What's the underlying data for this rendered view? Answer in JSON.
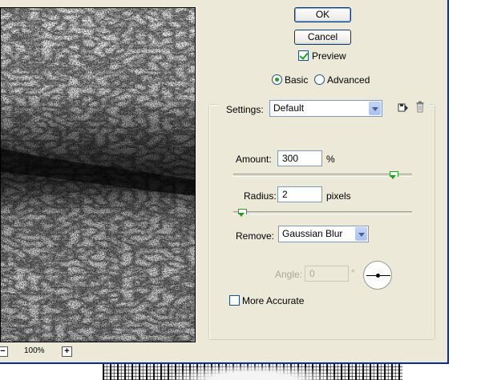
{
  "buttons": {
    "ok": "OK",
    "cancel": "Cancel"
  },
  "preview": {
    "label": "Preview",
    "checked": true
  },
  "mode": {
    "basic": "Basic",
    "advanced": "Advanced",
    "selected": "Basic"
  },
  "settings": {
    "label": "Settings:",
    "value": "Default",
    "save_icon": "save-settings-icon",
    "delete_icon": "trash-icon"
  },
  "amount": {
    "label": "Amount:",
    "value": "300",
    "unit": "%",
    "slider_fraction": 0.92
  },
  "radius": {
    "label": "Radius:",
    "value": "2",
    "unit": "pixels",
    "slider_fraction": 0.02
  },
  "remove": {
    "label": "Remove:",
    "value": "Gaussian Blur"
  },
  "angle": {
    "label": "Angle:",
    "value": "0",
    "unit": "°"
  },
  "more_accurate": {
    "label": "More Accurate",
    "checked": false
  },
  "zoom": {
    "level": "100%",
    "minus_icon": "zoom-out-icon",
    "plus_icon": "zoom-in-icon"
  },
  "colors": {
    "dialog_bg": "#ece9d8",
    "accent_border": "#0b2a9e",
    "check_mark": "#21a121"
  }
}
